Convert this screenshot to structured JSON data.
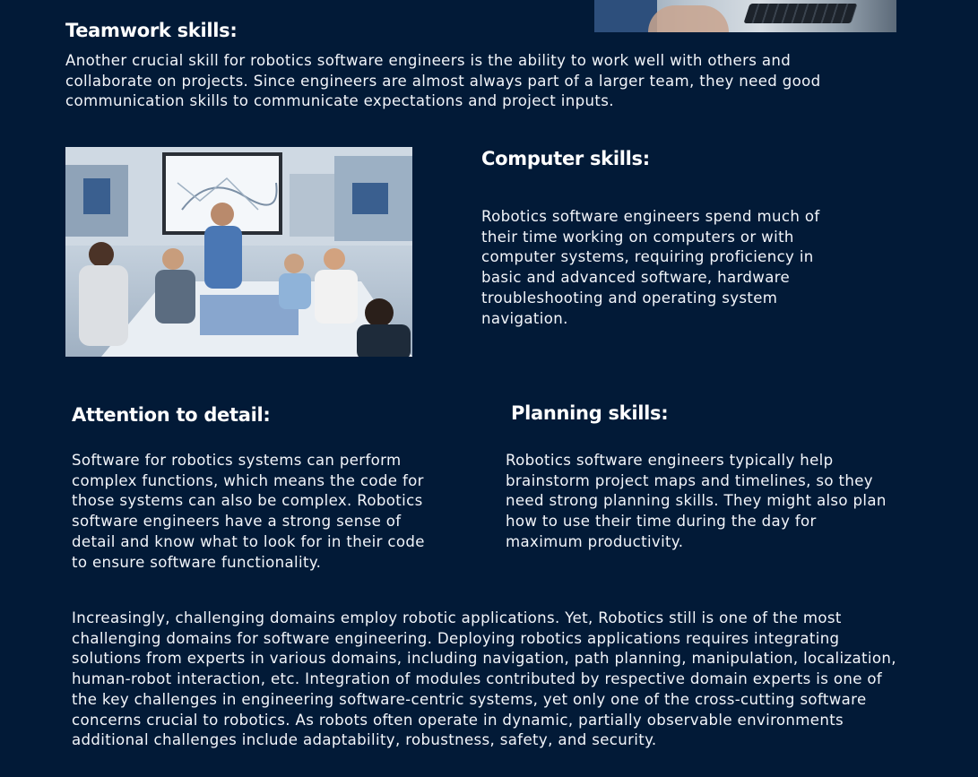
{
  "sections": {
    "teamwork": {
      "heading": "Teamwork skills:",
      "body": "Another crucial skill for robotics software engineers is the ability to work well with others and collaborate on projects. Since engineers are almost always part of a larger team, they need good communication skills to communicate expectations and project inputs."
    },
    "computer": {
      "heading": "Computer skills:",
      "body": "Robotics software engineers spend much of their time working on computers or with computer systems, requiring proficiency in basic and advanced software, hardware troubleshooting and operating system navigation."
    },
    "attention": {
      "heading": "Attention to detail:",
      "body": "Software for robotics systems can perform complex functions, which means the code for those systems can also be complex. Robotics software engineers have a strong sense of detail and know what to look for in their code to ensure software functionality."
    },
    "planning": {
      "heading": "Planning skills:",
      "body": "Robotics software engineers typically help brainstorm project maps and timelines, so they need strong planning skills. They might also plan how to use their time during the day for maximum productivity."
    }
  },
  "closing_paragraph": "Increasingly, challenging domains employ robotic applications. Yet, Robotics still is one of the most challenging domains for software engineering. Deploying robotics applications requires integrating solutions from experts in various domains, including navigation, path planning, manipulation, localization, human-robot interaction, etc. Integration of modules contributed by respective domain experts is one of the key challenges in engineering software-centric systems, yet only one of the cross-cutting software concerns crucial to robotics. As robots often operate in dynamic, partially observable environments additional challenges include adaptability, robustness, safety, and security.",
  "colors": {
    "background": "#021a37",
    "text": "#ffffff"
  }
}
